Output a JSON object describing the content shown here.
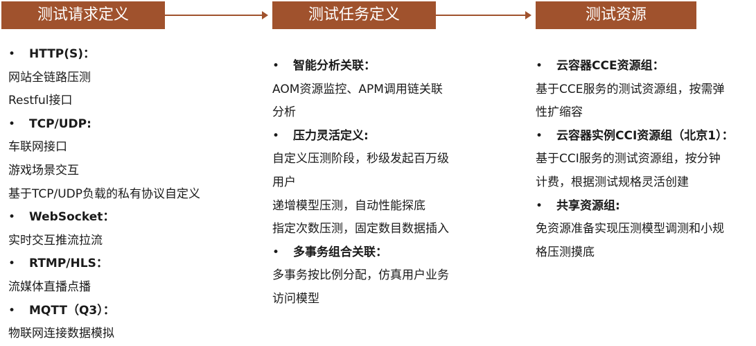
{
  "headers": [
    "测试请求定义",
    "测试任务定义",
    "测试资源"
  ],
  "col1": [
    {
      "type": "bullet",
      "text": "HTTP(S)："
    },
    {
      "type": "text",
      "text": "网站全链路压测"
    },
    {
      "type": "text",
      "text": "Restful接口"
    },
    {
      "type": "bullet",
      "text": "TCP/UDP:"
    },
    {
      "type": "text",
      "text": "车联网接口"
    },
    {
      "type": "text",
      "text": "游戏场景交互"
    },
    {
      "type": "text",
      "text": "基于TCP/UDP负载的私有协议自定义"
    },
    {
      "type": "bullet",
      "text": "WebSocket："
    },
    {
      "type": "text",
      "text": "实时交互推流拉流"
    },
    {
      "type": "bullet",
      "text": "RTMP/HLS："
    },
    {
      "type": "text",
      "text": "流媒体直播点播"
    },
    {
      "type": "bullet",
      "text": "MQTT（Q3）："
    },
    {
      "type": "text",
      "text": "物联网连接数据模拟"
    }
  ],
  "col2": [
    {
      "type": "bullet",
      "text": "智能分析关联："
    },
    {
      "type": "text",
      "text": "AOM资源监控、APM调用链关联"
    },
    {
      "type": "text",
      "text": "分析"
    },
    {
      "type": "bullet",
      "text": "压力灵活定义:"
    },
    {
      "type": "text",
      "text": "自定义压测阶段，秒级发起百万级"
    },
    {
      "type": "text",
      "text": "用户"
    },
    {
      "type": "text",
      "text": "递增模型压测，自动性能探底"
    },
    {
      "type": "text",
      "text": "指定次数压测，固定数目数据插入"
    },
    {
      "type": "bullet",
      "text": "多事务组合关联："
    },
    {
      "type": "text",
      "text": "多事务按比例分配，仿真用户业务"
    },
    {
      "type": "text",
      "text": "访问模型"
    }
  ],
  "col3": [
    {
      "type": "bullet",
      "text": "云容器CCE资源组："
    },
    {
      "type": "text",
      "text": "基于CCE服务的测试资源组，按需弹"
    },
    {
      "type": "text",
      "text": "性扩缩容"
    },
    {
      "type": "bullet",
      "text": "云容器实例CCI资源组（北京1）："
    },
    {
      "type": "text",
      "text": "基于CCI服务的测试资源组，按分钟"
    },
    {
      "type": "text",
      "text": "计费，根据测试规格灵活创建"
    },
    {
      "type": "bullet",
      "text": "共享资源组:"
    },
    {
      "type": "text",
      "text": "免资源准备实现压测模型调测和小规"
    },
    {
      "type": "text",
      "text": "格压测摸底"
    }
  ],
  "bullet_symbol": "•",
  "colors": {
    "header_bg": "#a0522d",
    "header_text": "#ffffff",
    "arrow": "#a0522d"
  }
}
